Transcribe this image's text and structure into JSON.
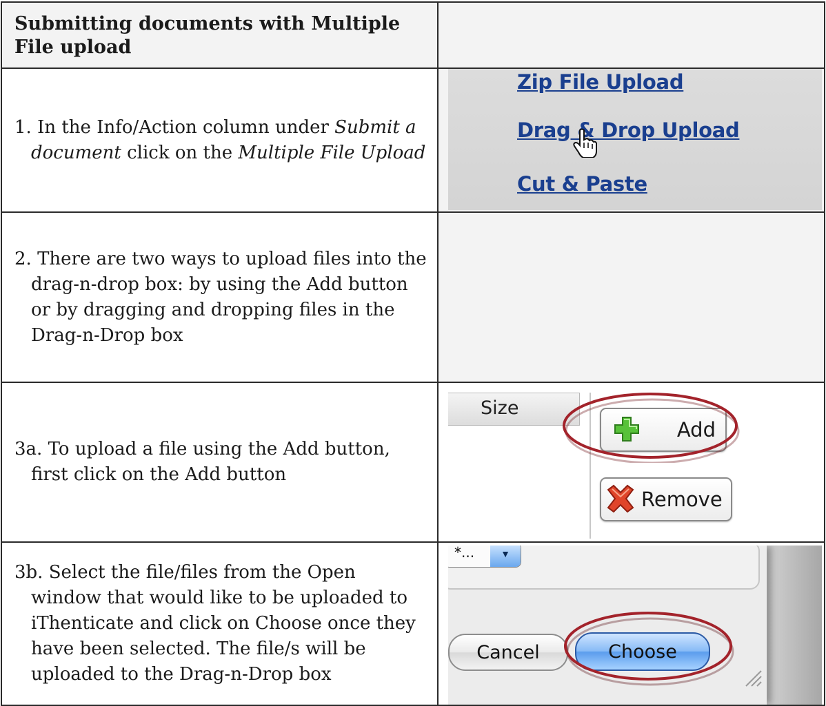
{
  "header": {
    "title": "Submitting documents with Multiple File upload"
  },
  "steps": [
    {
      "number": "1.",
      "text_before": " In the Info/Action column under ",
      "em1": "Submit a document",
      "text_middle": " click on the ",
      "em2": "Multiple File Upload"
    },
    {
      "text": "2. There are two ways to upload files into the drag-n-drop box: by using the Add button or by dragging and dropping files in the Drag-n-Drop box"
    },
    {
      "text": "3a. To upload a file using the Add button, first click on the Add button"
    },
    {
      "text": "3b. Select the file/files from the Open window that would like to be uploaded to iThenticate and click on Choose once they have been selected. The file/s will be uploaded to the Drag-n-Drop box"
    }
  ],
  "shot_links": {
    "items": [
      "Zip File Upload",
      "Drag & Drop Upload",
      "Cut & Paste"
    ]
  },
  "shot_buttons": {
    "column_header": "Size",
    "add_label": "Add",
    "remove_label": "Remove"
  },
  "shot_dialog": {
    "popup_value": "*...",
    "cancel_label": "Cancel",
    "choose_label": "Choose"
  },
  "colors": {
    "link": "#1a3f8f",
    "highlight_ring": "#a3232b",
    "aqua_button": "#5c9ded"
  },
  "icons": [
    "hand-cursor-icon",
    "plus-icon",
    "remove-x-icon",
    "dropdown-arrow-icon",
    "resize-grip-icon"
  ]
}
